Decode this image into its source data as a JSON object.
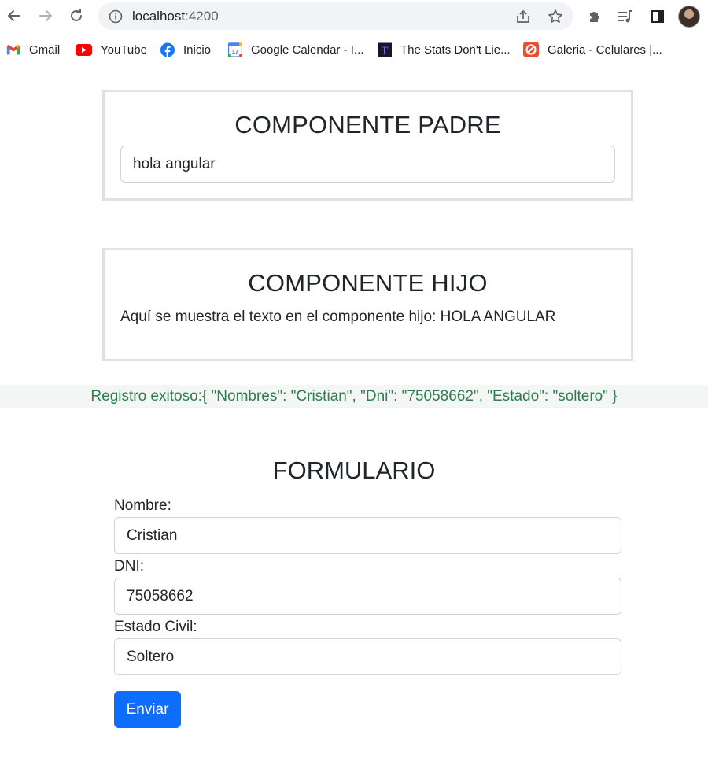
{
  "browser": {
    "url_host": "localhost",
    "url_port": ":4200",
    "bookmarks": [
      {
        "label": "Gmail",
        "icon": "gmail-icon"
      },
      {
        "label": "YouTube",
        "icon": "youtube-icon"
      },
      {
        "label": "Inicio",
        "icon": "facebook-icon"
      },
      {
        "label": "Google Calendar - I...",
        "icon": "google-calendar-icon"
      },
      {
        "label": "The Stats Don't Lie...",
        "icon": "stats-site-icon"
      },
      {
        "label": "Galeria - Celulares |...",
        "icon": "galeria-icon"
      }
    ],
    "calendar_day": "17",
    "stats_letter": "T"
  },
  "padre": {
    "title": "COMPONENTE PADRE",
    "input_value": "hola angular"
  },
  "hijo": {
    "title": "COMPONENTE HIJO",
    "message": "Aquí se muestra el texto en el componente hijo: HOLA ANGULAR"
  },
  "alert": {
    "text": "Registro exitoso:{ \"Nombres\": \"Cristian\", \"Dni\": \"75058662\", \"Estado\": \"soltero\" }"
  },
  "form": {
    "title": "FORMULARIO",
    "nombre_label": "Nombre:",
    "nombre_value": "Cristian",
    "dni_label": "DNI:",
    "dni_value": "75058662",
    "estado_label": "Estado Civil:",
    "estado_value": "Soltero",
    "submit_label": "Enviar"
  },
  "colors": {
    "primary": "#0d6efd",
    "success_text": "#2e7d4f",
    "card_border": "#dee2e6"
  }
}
